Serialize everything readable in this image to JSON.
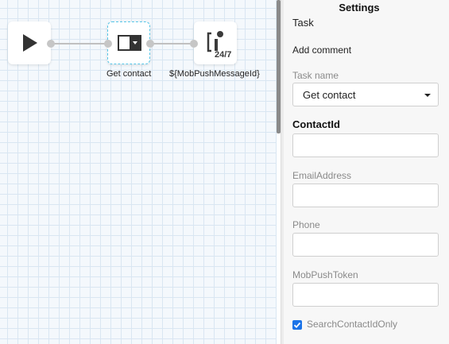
{
  "canvas": {
    "nodes": [
      {
        "id": "start",
        "icon": "play-icon",
        "label": ""
      },
      {
        "id": "get-contact",
        "icon": "task-select-icon",
        "label": "Get contact"
      },
      {
        "id": "mob-push",
        "icon": "push-247-icon",
        "label": "${MobPushMessageId}",
        "badge": "24/7"
      }
    ]
  },
  "settings": {
    "title": "Settings",
    "task_label": "Task",
    "add_comment": "Add comment",
    "task_name_label": "Task name",
    "task_name_value": "Get contact",
    "fields": [
      {
        "label": "ContactId",
        "value": ""
      },
      {
        "label": "EmailAddress",
        "value": ""
      },
      {
        "label": "Phone",
        "value": ""
      },
      {
        "label": "MobPushToken",
        "value": ""
      }
    ],
    "checkbox": {
      "label": "SearchContactIdOnly",
      "checked": true
    }
  },
  "colors": {
    "accent": "#1a73e8",
    "selected_node_border": "#56c6e8",
    "grid": "#d9e6f2"
  }
}
